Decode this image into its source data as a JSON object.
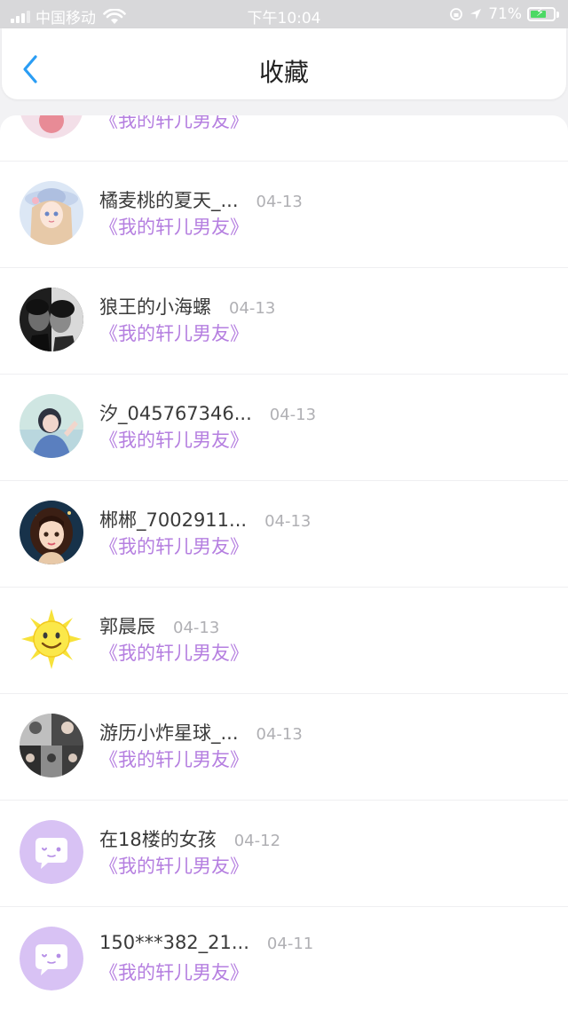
{
  "status_bar": {
    "carrier": "中国移动",
    "time": "下午10:04",
    "battery": "71%",
    "battery_level": 0.71
  },
  "header": {
    "title": "收藏"
  },
  "accent_color": "#b57fe0",
  "items": [
    {
      "name": "",
      "date": "",
      "book": "《我的轩儿男友》",
      "avatar": "pastel-photo"
    },
    {
      "name": "橘麦桃的夏天_...",
      "date": "04-13",
      "book": "《我的轩儿男友》",
      "avatar": "anime-girl-hat"
    },
    {
      "name": "狼王的小海螺",
      "date": "04-13",
      "book": "《我的轩儿男友》",
      "avatar": "bw-couple-photo"
    },
    {
      "name": "汐_045767346...",
      "date": "04-13",
      "book": "《我的轩儿男友》",
      "avatar": "girl-photo"
    },
    {
      "name": "郴郴_7002911...",
      "date": "04-13",
      "book": "《我的轩儿男友》",
      "avatar": "illustrated-girl"
    },
    {
      "name": "郭晨辰",
      "date": "04-13",
      "book": "《我的轩儿男友》",
      "avatar": "smiling-sun"
    },
    {
      "name": "游历小炸星球_...",
      "date": "04-13",
      "book": "《我的轩儿男友》",
      "avatar": "collage-photo"
    },
    {
      "name": "在18楼的女孩",
      "date": "04-12",
      "book": "《我的轩儿男友》",
      "avatar": "default-chat-bubble"
    },
    {
      "name": "150***382_21...",
      "date": "04-11",
      "book": "《我的轩儿男友》",
      "avatar": "default-chat-bubble"
    }
  ]
}
